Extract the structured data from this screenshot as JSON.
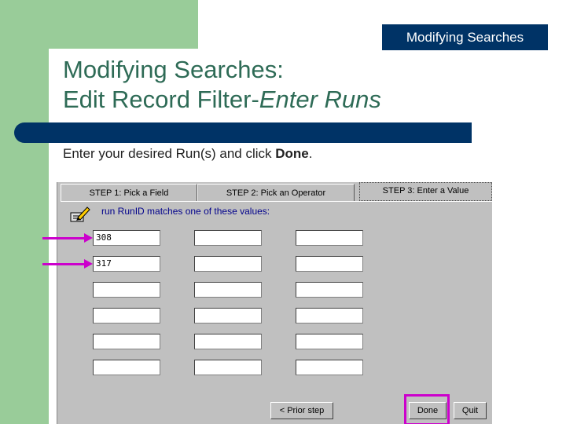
{
  "header": {
    "badge": "Modifying Searches"
  },
  "title": {
    "line1": "Modifying Searches:",
    "line2_normal": "Edit Record Filter-",
    "line2_italic": "Enter Runs"
  },
  "instruction": {
    "text": "Enter your desired Run(s) and click ",
    "bold": "Done",
    "end": "."
  },
  "dialog": {
    "tabs": [
      "STEP 1: Pick a Field",
      "STEP 2: Pick an Operator",
      "STEP 3: Enter a Value"
    ],
    "query_label": "run RunID matches one of these values:",
    "values": [
      [
        "308",
        "",
        ""
      ],
      [
        "317",
        "",
        ""
      ],
      [
        "",
        "",
        ""
      ],
      [
        "",
        "",
        ""
      ],
      [
        "",
        "",
        ""
      ],
      [
        "",
        "",
        ""
      ]
    ],
    "buttons": {
      "prior": "< Prior step",
      "done": "Done",
      "quit": "Quit"
    }
  },
  "colors": {
    "green": "#99cc99",
    "navy": "#003366",
    "title": "#2e6b56",
    "highlight": "#cc00cc"
  }
}
